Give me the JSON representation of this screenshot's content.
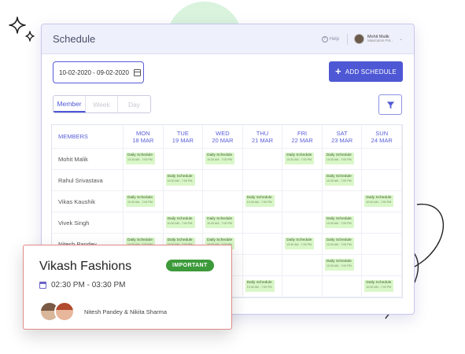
{
  "window": {
    "title": "Schedule",
    "help_label": "Help",
    "user_name": "Mohit Malik",
    "user_company": "Maxicolors Pvt..."
  },
  "toolbar": {
    "date_range": "10-02-2020 - 09-02-2020",
    "add_label": "ADD SCHEDULE"
  },
  "view_tabs": [
    "Member",
    "Week",
    "Day"
  ],
  "columns": {
    "members_header": "MEMBERS",
    "days": [
      {
        "day": "MON",
        "date": "18 MAR"
      },
      {
        "day": "TUE",
        "date": "19 MAR"
      },
      {
        "day": "WED",
        "date": "20 MAR"
      },
      {
        "day": "THU",
        "date": "21 MAR"
      },
      {
        "day": "FRI",
        "date": "22 MAR"
      },
      {
        "day": "SAT",
        "date": "23 MAR"
      },
      {
        "day": "SUN",
        "date": "24 MAR"
      }
    ]
  },
  "members": [
    "Mohit Malik",
    "Rahul Srivastava",
    "Vikas Kaushik",
    "Vivek Singh",
    "Nitesh Pandey",
    "",
    ""
  ],
  "schedule_label": "Daily Schedule",
  "schedule_time": "10:30 AM - 7:00 PM",
  "schedule": [
    [
      0,
      2,
      4,
      5
    ],
    [
      1,
      5
    ],
    [
      0,
      3,
      6
    ],
    [
      1,
      2,
      5
    ],
    [
      0,
      1,
      2,
      4,
      5
    ],
    [
      5
    ],
    [
      3,
      6
    ]
  ],
  "card": {
    "title": "Vikash Fashions",
    "badge": "IMPORTANT",
    "time": "02:30 PM - 03:30 PM",
    "people": "Nitesh Pandey & Nikita Sharma"
  },
  "colors": {
    "accent": "#4e58d4",
    "chip_bg": "#d9f7c8",
    "badge_bg": "#3c9a3a",
    "card_border": "#e38a8a"
  }
}
